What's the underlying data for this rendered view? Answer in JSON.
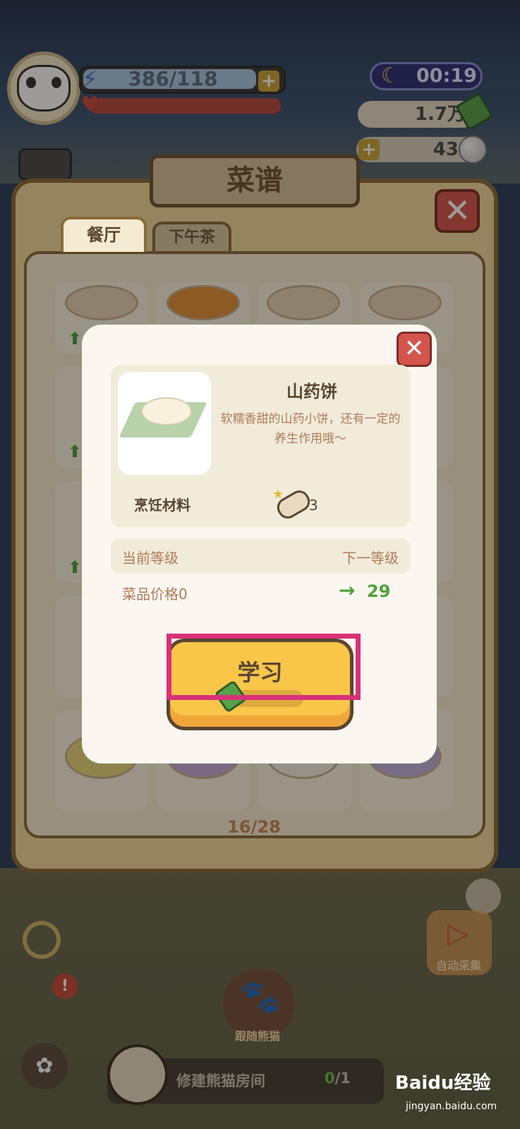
{
  "hud": {
    "energy": "386/118",
    "clock": "00:19",
    "money": "1.7万",
    "pearls": "43",
    "plus": "+"
  },
  "recipe_book": {
    "title": "菜谱",
    "tabs": [
      "餐厅",
      "下午茶"
    ],
    "page": "16/28",
    "close": "✕"
  },
  "dish_modal": {
    "name": "山药饼",
    "description": "软糯香甜的山药小饼，还有一定的养生作用哦～",
    "ingredient_label": "烹饪材料",
    "ingredient_count": "3",
    "current_level_label": "当前等级",
    "next_level_label": "下一等级",
    "price_label": "菜品价格0",
    "price_arrow": "→",
    "next_price": "29",
    "learn_button": "学习",
    "close": "✕"
  },
  "bottom_hud": {
    "follow_label": "跟随熊猫",
    "auto_label": "自动采集",
    "task_text": "修建熊猫房间",
    "task_done": "0",
    "task_total": "/1",
    "alert": "!"
  },
  "watermark": {
    "brand": "Baidu经验",
    "url": "jingyan.baidu.com"
  },
  "colors": {
    "panel_bg": "#efd89a",
    "panel_border": "#8a6a3a",
    "learn_button": "#f9c64a",
    "highlight": "#d8317a",
    "price_up": "#4fa13b",
    "close_red": "#d4554b"
  }
}
